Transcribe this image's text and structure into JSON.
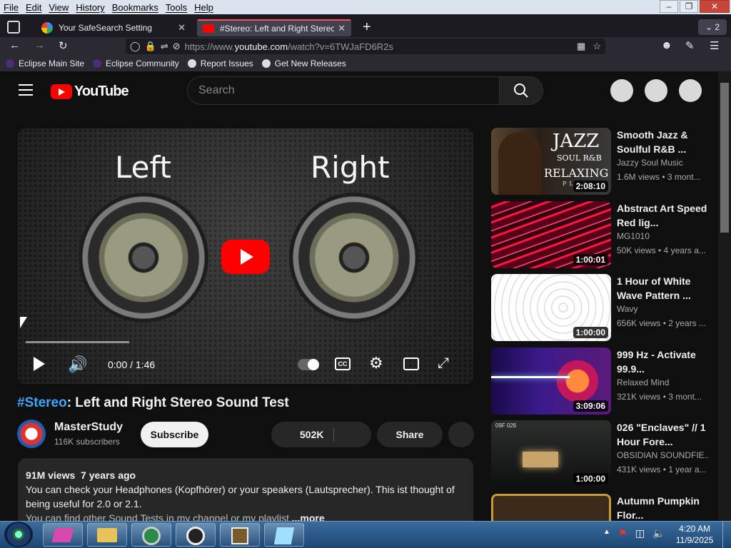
{
  "menu": [
    "File",
    "Edit",
    "View",
    "History",
    "Bookmarks",
    "Tools",
    "Help"
  ],
  "tabs": [
    {
      "title": "Your SafeSearch Setting",
      "active": false
    },
    {
      "title": "#Stereo: Left and Right Stereo So",
      "active": true
    }
  ],
  "tab_count": "2",
  "url": {
    "prefix": "https://www.",
    "domain": "youtube.com",
    "path": "/watch?v=6TWJaFD6R2s"
  },
  "bookmarks": [
    "Eclipse Main Site",
    "Eclipse Community",
    "Report Issues",
    "Get New Releases"
  ],
  "youtube": {
    "logo_text": "YouTube",
    "search_placeholder": "Search",
    "video": {
      "label_left": "Left",
      "label_right": "Right",
      "time": "0:00 / 1:46",
      "progress": 0.0
    },
    "title_hash": "#Stereo",
    "title_rest": ": Left and Right Stereo Sound Test",
    "channel": "MasterStudy",
    "subscribers": "116K subscribers",
    "subscribe_label": "Subscribe",
    "likes": "502K",
    "share_label": "Share",
    "description": {
      "views": "91M views",
      "age": "7 years ago",
      "line1": "You can check your Headphones (Kopfhörer) or your speakers (Lautsprecher). This ist thought of",
      "line2": "being useful for 2.0 or 2.1.",
      "line3": "You can find other Sound Tests in my channel or my playlist",
      "more": "...more"
    },
    "recommendations": [
      {
        "title": "Smooth Jazz & Soulful R&B ...",
        "channel": "Jazzy Soul Music",
        "meta": "1.6M views • 3 mont...",
        "duration": "2:08:10"
      },
      {
        "title": "Abstract Art Speed Red lig...",
        "channel": "MG1010",
        "meta": "50K views • 4 years a...",
        "duration": "1:00:01"
      },
      {
        "title": "1 Hour of White Wave Pattern ...",
        "channel": "Wavy",
        "meta": "656K views • 2 years ...",
        "duration": "1:00:00"
      },
      {
        "title": "999 Hz - Activate 99.9...",
        "channel": "Relaxed Mind",
        "meta": "321K views • 3 mont...",
        "duration": "3:09:06"
      },
      {
        "title": "026 \"Enclaves\" // 1 Hour Fore...",
        "channel": "OBSIDIAN SOUNDFIE...",
        "meta": "431K views • 1 year a...",
        "duration": "1:00:00"
      },
      {
        "title": "Autumn Pumpkin Flor...",
        "channel": "",
        "meta": "",
        "duration": ""
      }
    ],
    "thumb1_text": {
      "big": "JAZZ",
      "mid": "SOUL R&B",
      "low": "RELAXING",
      "tiny": "PLAY"
    },
    "thumb5_tag": "09F  026"
  },
  "tray": {
    "time": "4:20 AM",
    "date": "11/9/2025"
  },
  "colors": {
    "accent": "#ff0000",
    "link": "#3ea6ff",
    "tab_active_top": "#ff4f5e"
  }
}
